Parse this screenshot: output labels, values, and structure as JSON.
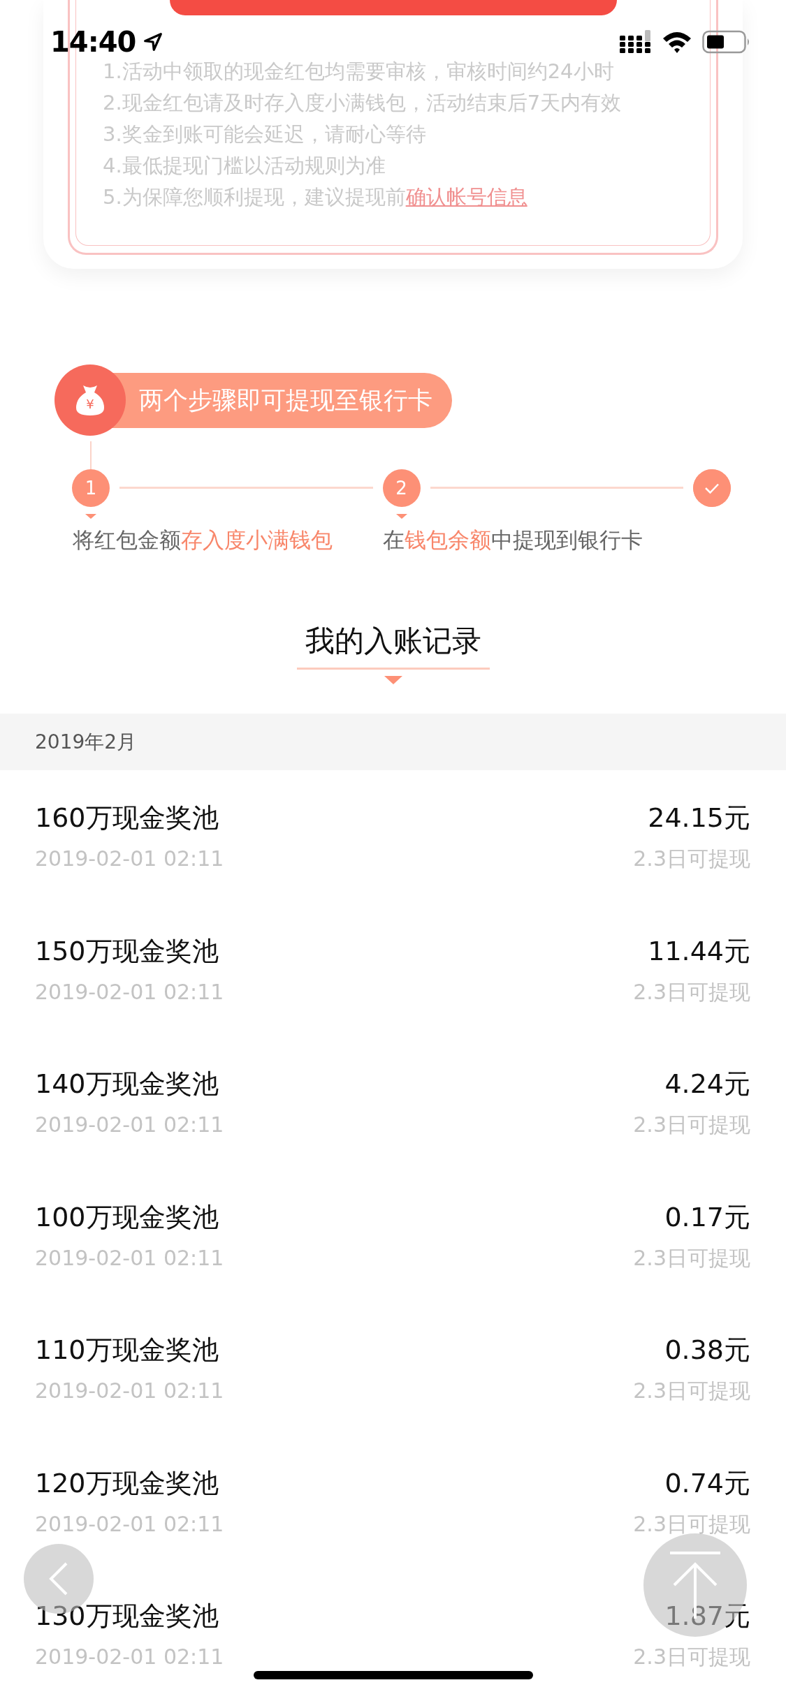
{
  "status_bar": {
    "time": "14:40"
  },
  "rules": {
    "items": [
      {
        "text": "1.活动中领取的现金红包均需要审核，审核时间约24小时"
      },
      {
        "text": "2.现金红包请及时存入度小满钱包，活动结束后7天内有效"
      },
      {
        "text": "3.奖金到账可能会延迟，请耐心等待"
      },
      {
        "text": "4.最低提现门槛以活动规则为准"
      },
      {
        "text": "5.为保障您顺利提现，建议提现前",
        "link": "确认帐号信息"
      }
    ]
  },
  "steps": {
    "symbol": "¥",
    "title": "两个步骤即可提现至银行卡",
    "markers": [
      {
        "kind": "number",
        "label": "1"
      },
      {
        "kind": "number",
        "label": "2"
      },
      {
        "kind": "check"
      }
    ],
    "captions": [
      [
        {
          "text": "将红包金额",
          "highlight": false
        },
        {
          "text": "存入度小满钱包",
          "highlight": true
        }
      ],
      [
        {
          "text": "在",
          "highlight": false
        },
        {
          "text": "钱包余额",
          "highlight": true
        },
        {
          "text": "中提现到银行卡",
          "highlight": false
        }
      ]
    ]
  },
  "records": {
    "title": "我的入账记录",
    "month": "2019年2月",
    "rows": [
      {
        "name": "160万现金奖池",
        "time": "2019-02-01 02:11",
        "amount": "24.15元",
        "status": "2.3日可提现"
      },
      {
        "name": "150万现金奖池",
        "time": "2019-02-01 02:11",
        "amount": "11.44元",
        "status": "2.3日可提现"
      },
      {
        "name": "140万现金奖池",
        "time": "2019-02-01 02:11",
        "amount": "4.24元",
        "status": "2.3日可提现"
      },
      {
        "name": "100万现金奖池",
        "time": "2019-02-01 02:11",
        "amount": "0.17元",
        "status": "2.3日可提现"
      },
      {
        "name": "110万现金奖池",
        "time": "2019-02-01 02:11",
        "amount": "0.38元",
        "status": "2.3日可提现"
      },
      {
        "name": "120万现金奖池",
        "time": "2019-02-01 02:11",
        "amount": "0.74元",
        "status": "2.3日可提现"
      },
      {
        "name": "130万现金奖池",
        "time": "2019-02-01 02:11",
        "amount": "1.87元",
        "status": "2.3日可提现"
      }
    ]
  }
}
